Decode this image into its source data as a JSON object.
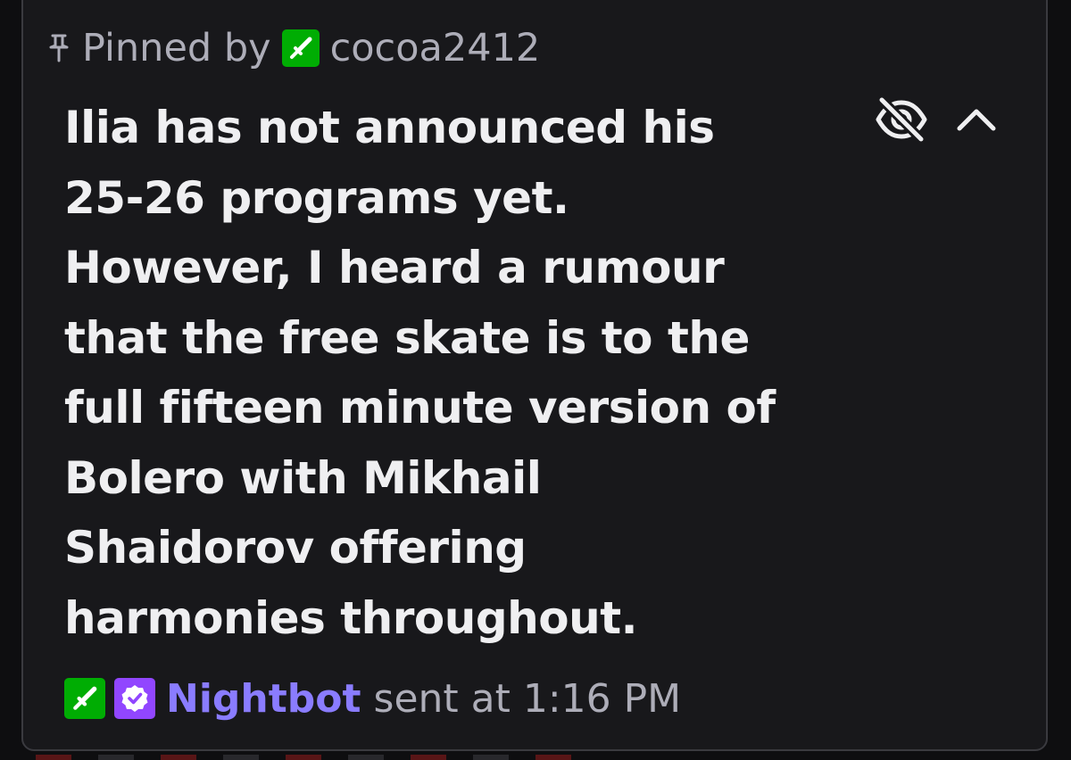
{
  "pinned": {
    "label": "Pinned by",
    "pinner": "cocoa2412",
    "icons": [
      "pin-icon",
      "moderator-sword-badge-icon"
    ]
  },
  "message": {
    "lines": [
      "Ilia has not announced his",
      "25-26 programs yet.",
      "However, I heard a rumour",
      "that the free skate is to the",
      "full fifteen minute version of",
      "Bolero with Mikhail",
      "Shaidorov offering",
      "harmonies throughout."
    ]
  },
  "actions": {
    "icons": [
      "eye-off-icon",
      "chevron-up-icon"
    ]
  },
  "footer": {
    "sender": "Nightbot",
    "sent_text": "sent at 1:16 PM",
    "badges": [
      "moderator-sword-badge-icon",
      "verified-bot-badge-icon"
    ]
  },
  "colors": {
    "background": "#0e0e10",
    "card": "#18181b",
    "border": "#3a3a3f",
    "text_primary": "#efeff1",
    "text_secondary": "#adadb8",
    "moderator_badge": "#00ad03",
    "verified_badge": "#9146ff",
    "sender_name": "#8a7cff"
  }
}
